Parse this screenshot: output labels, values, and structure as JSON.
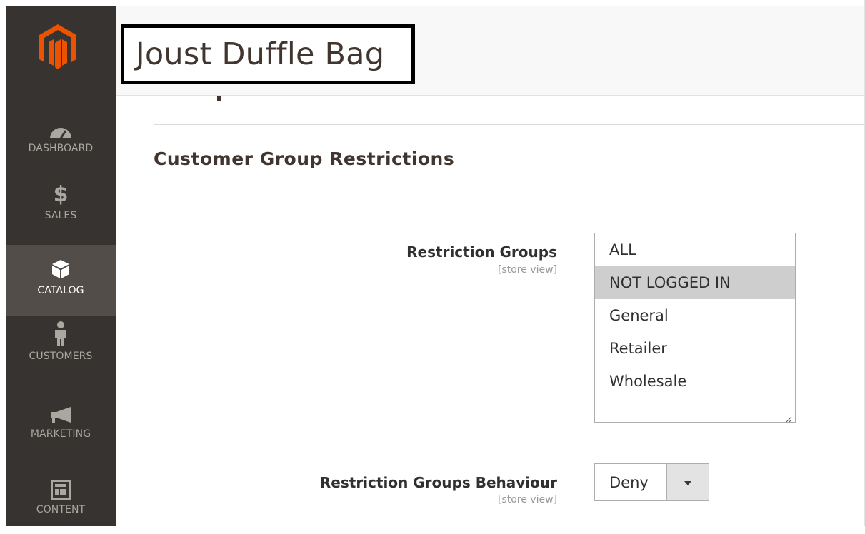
{
  "sidebar": {
    "logo_icon": "magento-logo-icon",
    "items": [
      {
        "label": "DASHBOARD",
        "icon": "dashboard-gauge-icon"
      },
      {
        "label": "SALES",
        "icon": "dollar-icon"
      },
      {
        "label": "CATALOG",
        "icon": "cube-icon",
        "active": true
      },
      {
        "label": "CUSTOMERS",
        "icon": "person-icon"
      },
      {
        "label": "MARKETING",
        "icon": "megaphone-icon"
      },
      {
        "label": "CONTENT",
        "icon": "layout-icon"
      }
    ]
  },
  "header": {
    "title": "Joust Duffle Bag"
  },
  "section": {
    "title": "Customer Group Restrictions"
  },
  "fields": {
    "restriction_groups": {
      "label": "Restriction Groups",
      "scope": "[store view]",
      "options": [
        "ALL",
        "NOT LOGGED IN",
        "General",
        "Retailer",
        "Wholesale"
      ],
      "selected": "NOT LOGGED IN"
    },
    "restriction_behaviour": {
      "label": "Restriction Groups Behaviour",
      "scope": "[store view]",
      "value": "Deny"
    }
  },
  "colors": {
    "sidebar_bg": "#373330",
    "sidebar_active": "#524d49",
    "brand_orange": "#eb5202"
  }
}
